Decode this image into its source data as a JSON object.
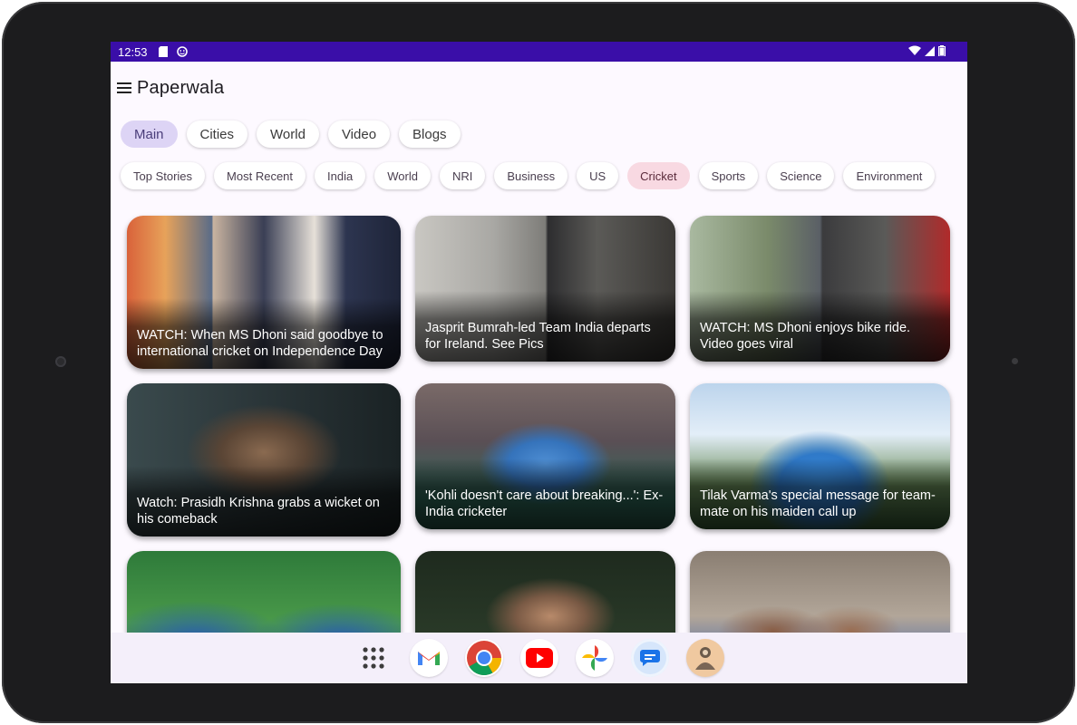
{
  "status": {
    "time": "12:53"
  },
  "app": {
    "title": "Paperwala"
  },
  "main_tabs": [
    "Main",
    "Cities",
    "World",
    "Video",
    "Blogs"
  ],
  "category_tabs": [
    "Top Stories",
    "Most Recent",
    "India",
    "World",
    "NRI",
    "Business",
    "US",
    "Cricket",
    "Sports",
    "Science",
    "Environment"
  ],
  "active_main_tab": "Main",
  "active_category": "Cricket",
  "cards": [
    {
      "caption": "WATCH: When MS Dhoni said goodbye to international cricket on Independence Day"
    },
    {
      "caption": "Jasprit Bumrah-led Team India departs for Ireland. See Pics"
    },
    {
      "caption": "WATCH: MS Dhoni enjoys bike ride. Video goes viral"
    },
    {
      "caption": "Watch: Prasidh Krishna grabs a wicket on his comeback"
    },
    {
      "caption": "'Kohli doesn't care about breaking...': Ex-India cricketer"
    },
    {
      "caption": "Tilak Varma's special message for team-mate on his maiden call up"
    },
    {
      "caption": ""
    },
    {
      "caption": ""
    },
    {
      "caption": ""
    }
  ],
  "dock": [
    {
      "name": "all-apps",
      "icon": "apps-grid-icon"
    },
    {
      "name": "gmail",
      "icon": "gmail-icon"
    },
    {
      "name": "chrome",
      "icon": "chrome-icon"
    },
    {
      "name": "youtube",
      "icon": "youtube-icon"
    },
    {
      "name": "photos",
      "icon": "photos-icon"
    },
    {
      "name": "messages",
      "icon": "messages-icon"
    },
    {
      "name": "contacts-app",
      "icon": "avatar-app-icon"
    }
  ],
  "colors": {
    "status_bar": "#3a0ea8",
    "active_main_chip": "#ddd4f5",
    "active_category_chip": "#f8d9e2"
  }
}
